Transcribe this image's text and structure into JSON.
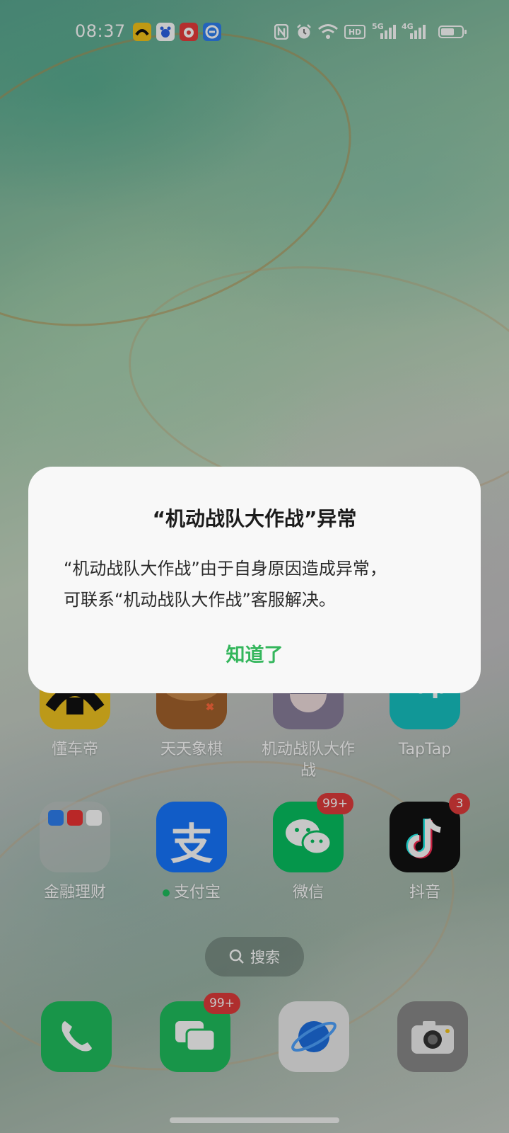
{
  "status_bar": {
    "time": "08:37",
    "network_5g": "5G",
    "network_4g": "4G",
    "hd_label": "HD",
    "battery_level": 0.65
  },
  "apps": [
    {
      "label": "懂车帝",
      "color": "#f1c420"
    },
    {
      "label": "天天象棋",
      "color": "#a3622c"
    },
    {
      "label": "机动战队大作战",
      "color": "#8a7f9c"
    },
    {
      "label": "TapTap",
      "color": "#17c2c2",
      "tile_text": "Tap"
    },
    {
      "label": "金融理财",
      "color": "#c9c9c9"
    },
    {
      "label": "支付宝",
      "color": "#1677ff",
      "tile_text": "支"
    },
    {
      "label": "微信",
      "color": "#07c160",
      "badge": "99+"
    },
    {
      "label": "抖音",
      "color": "#111111",
      "badge": "3"
    }
  ],
  "search": {
    "label": "搜索"
  },
  "dock": [
    {
      "name": "phone",
      "color": "#1fbf5e"
    },
    {
      "name": "messages",
      "color": "#1fbf5e",
      "badge": "99+"
    },
    {
      "name": "browser",
      "color": "#eeeeee"
    },
    {
      "name": "camera",
      "color": "#8a8a8a"
    }
  ],
  "dialog": {
    "title": "“机动战队大作战”异常",
    "message_line1": "“机动战队大作战”由于自身原因造成异常，",
    "message_line2": "可联系“机动战队大作战”客服解决。",
    "ok_button": "知道了"
  }
}
